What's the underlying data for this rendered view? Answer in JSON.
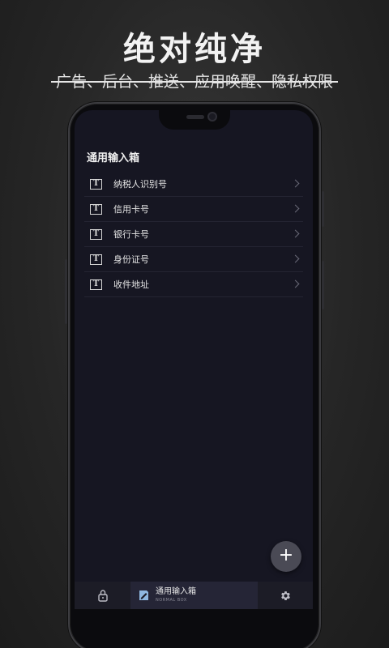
{
  "promo": {
    "title": "绝对纯净",
    "subtitle": "广告、后台、推送、应用唤醒、隐私权限"
  },
  "screen": {
    "list_title": "通用输入箱",
    "items": [
      {
        "label": "纳税人识别号",
        "icon": "text-icon"
      },
      {
        "label": "信用卡号",
        "icon": "text-icon"
      },
      {
        "label": "银行卡号",
        "icon": "text-icon"
      },
      {
        "label": "身份证号",
        "icon": "text-icon"
      },
      {
        "label": "收件地址",
        "icon": "text-icon"
      }
    ],
    "icon_glyph": "T",
    "fab_label": "+"
  },
  "bottom_nav": {
    "active_label": "通用输入箱",
    "active_sublabel": "NORMAL BOX",
    "icons": [
      "lock-icon",
      "note-icon",
      "gear-icon"
    ]
  },
  "colors": {
    "background": "#262626",
    "screen": "#161622",
    "nav_active": "#252536",
    "fab": "#4a4a55"
  }
}
